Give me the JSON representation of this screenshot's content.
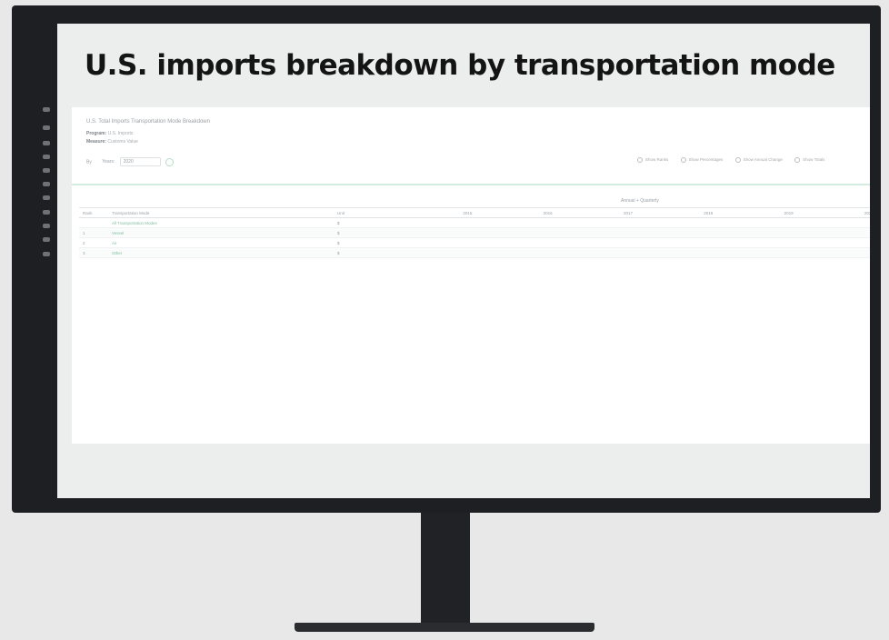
{
  "banner": {
    "title": "U.S. imports breakdown by transportation mode"
  },
  "app": {
    "title": "U.S. Total Imports Transportation Mode Breakdown",
    "meta": [
      {
        "label": "Program:",
        "value": "U.S. Imports"
      },
      {
        "label": "Measure:",
        "value": "Customs Value"
      }
    ],
    "controls": {
      "label": "By",
      "select_label": "Years:",
      "select_value": "2020"
    },
    "options": [
      "Show Ranks",
      "Show Percentages",
      "Show Annual Change",
      "Show Totals"
    ],
    "table_caption": "Annual + Quarterly",
    "table": {
      "columns": [
        "Rank",
        "Transportation Mode",
        "Unit",
        "2015",
        "2016",
        "2017",
        "2018",
        "2019",
        "2020"
      ],
      "rows": [
        [
          "",
          "All Transportation Modes",
          "$",
          "",
          "",
          "",
          "",
          "",
          ""
        ],
        [
          "1",
          "Vessel",
          "$",
          "",
          "",
          "",
          "",
          "",
          ""
        ],
        [
          "2",
          "Air",
          "$",
          "",
          "",
          "",
          "",
          "",
          ""
        ],
        [
          "3",
          "Other",
          "$",
          "",
          "",
          "",
          "",
          "",
          ""
        ]
      ]
    }
  },
  "rail_icons": [
    "home-icon",
    "grid-icon",
    "chart-icon",
    "list-icon",
    "table-icon",
    "filter-icon",
    "map-icon",
    "download-icon",
    "share-icon",
    "help-icon",
    "settings-icon"
  ],
  "colors": {
    "accent": "#7fbf9c",
    "bezel": "#1d1f22",
    "background": "#e8e8e8"
  }
}
